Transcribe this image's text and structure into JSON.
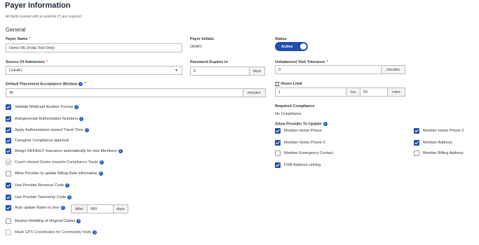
{
  "page": {
    "title": "Payer Information",
    "note": "All fields marked with an asterisk (*) are required.",
    "section": "General"
  },
  "fields": {
    "payer_name": {
      "label": "Payer Name",
      "value": "Demo ML (India Test Only)"
    },
    "payer_initials": {
      "label": "Payer Initials",
      "value": "DEMO"
    },
    "status": {
      "label": "Status",
      "value": "Active"
    },
    "source_of_admission": {
      "label": "Source Of Admission",
      "value": "CHHA1"
    },
    "password_expires": {
      "label": "Password Expires in",
      "value": "0",
      "unit": "days"
    },
    "unbalanced_visit_tolerance": {
      "label": "Unbalanced Visit Tolerance",
      "value": "0",
      "unit": "minutes"
    },
    "default_placement": {
      "label": "Default Placement Acceptance Window",
      "value": "45",
      "unit": "minutes"
    },
    "tt_hours_limit": {
      "label_prefix": "TT",
      "label_rest": " Hours Limit",
      "hrs_value": "1",
      "hrs_unit": "hrs",
      "mins_value": "59",
      "mins_unit": "mins"
    },
    "required_compliance": {
      "label": "Required Compliance",
      "value": "No Compliance"
    }
  },
  "left_checkboxes": [
    {
      "label": "Validate Medicaid Number Format",
      "checked": true,
      "info": true
    },
    {
      "label": "Autogenerate Authorization Numbers",
      "checked": true,
      "info": true
    },
    {
      "label": "Apply Authorizations toward Travel Time",
      "checked": true,
      "info": true
    },
    {
      "label": "Caregiver Compliance approval",
      "checked": true,
      "info": false
    },
    {
      "label": "Assign DEFAULT Insurance automatically for new Members",
      "checked": true,
      "info": true
    },
    {
      "label": "Count refused Duties towards Compliance Totals",
      "checked": "dim",
      "info": true
    },
    {
      "label": "Allow Provider to update Billing Rate information",
      "checked": false,
      "info": true
    },
    {
      "label": "Use Provider Revenue Code",
      "checked": true,
      "info": true
    },
    {
      "label": "Use Provider Taxonomy Code",
      "checked": true,
      "info": true
    },
    {
      "label": "Auto update Rates to zero",
      "checked": true,
      "info": true
    },
    {
      "label": "Restrict Rebilling of Original Claims",
      "checked": false,
      "info": true
    },
    {
      "label": "Mask GPS Coordinates for Community Visits",
      "checked": "dimoff",
      "info": true
    }
  ],
  "auto_update": {
    "after_label": "After",
    "value": "999",
    "unit": "days"
  },
  "allow_provider": {
    "label": "Allow Provider To Update",
    "items": [
      {
        "label": "Member Home Phone",
        "checked": true
      },
      {
        "label": "Member Home Phone 2",
        "checked": true
      },
      {
        "label": "Member Home Phone 3",
        "checked": true
      },
      {
        "label": "Member Address",
        "checked": true
      },
      {
        "label": "Member Emergency Contact",
        "checked": false
      },
      {
        "label": "Member Billing Address",
        "checked": false
      },
      {
        "label": "FOB-Address Linking",
        "checked": true
      }
    ]
  },
  "icons": {
    "info": "info-icon",
    "check": "check-icon",
    "dropdown": "chevron-down-icon"
  },
  "colors": {
    "accent": "#1f4fa8",
    "required": "#d92b2b"
  }
}
